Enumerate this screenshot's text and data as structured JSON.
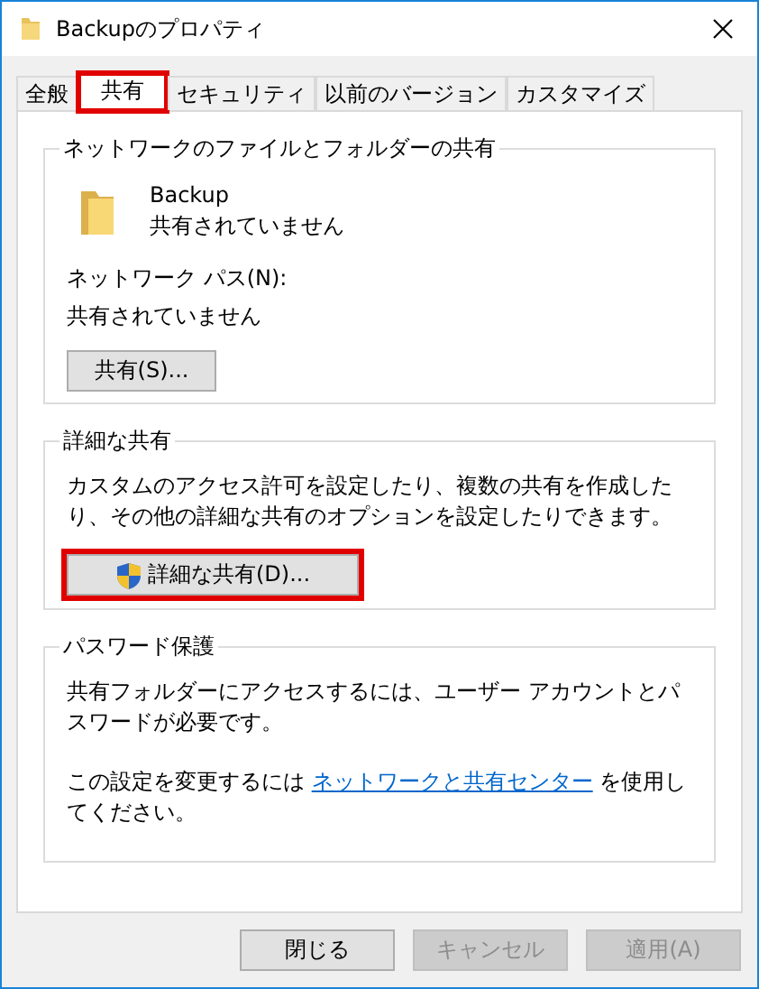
{
  "window": {
    "title": "Backupのプロパティ"
  },
  "tabs": [
    {
      "label": "全般",
      "selected": false,
      "highlighted": false
    },
    {
      "label": "共有",
      "selected": true,
      "highlighted": true
    },
    {
      "label": "セキュリティ",
      "selected": false,
      "highlighted": false
    },
    {
      "label": "以前のバージョン",
      "selected": false,
      "highlighted": false
    },
    {
      "label": "カスタマイズ",
      "selected": false,
      "highlighted": false
    }
  ],
  "network_sharing": {
    "legend": "ネットワークのファイルとフォルダーの共有",
    "folder_name": "Backup",
    "status": "共有されていません",
    "path_label": "ネットワーク パス(N):",
    "path_value": "共有されていません",
    "button": {
      "label": "共有(S)...",
      "highlighted": false
    }
  },
  "advanced_sharing": {
    "legend": "詳細な共有",
    "description": "カスタムのアクセス許可を設定したり、複数の共有を作成したり、その他の詳細な共有のオプションを設定したりできます。",
    "button": {
      "label": "詳細な共有(D)...",
      "highlighted": true
    }
  },
  "password_protection": {
    "legend": "パスワード保護",
    "description": "共有フォルダーにアクセスするには、ユーザー アカウントとパスワードが必要です。",
    "change_before": "この設定を変更するには ",
    "link": "ネットワークと共有センター",
    "change_after": " を使用してください。"
  },
  "buttons": [
    {
      "label": "閉じる",
      "disabled": false
    },
    {
      "label": "キャンセル",
      "disabled": true
    },
    {
      "label": "適用(A)",
      "disabled": true
    }
  ]
}
